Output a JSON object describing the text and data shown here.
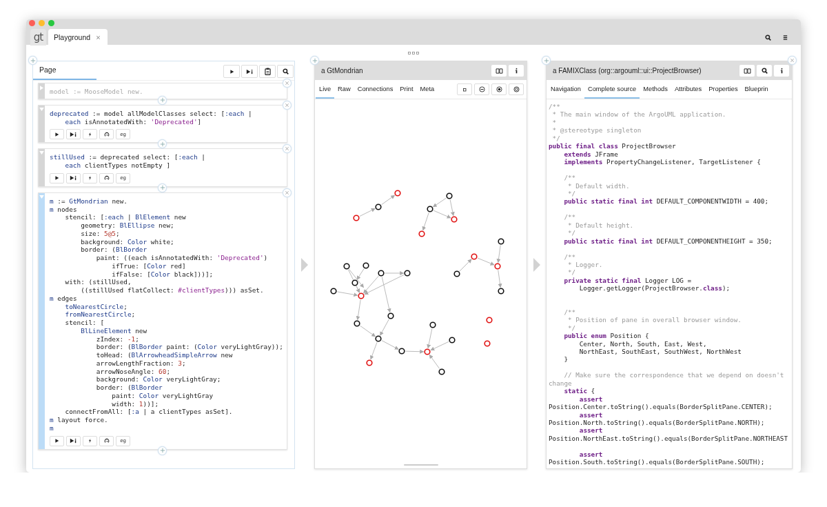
{
  "window": {
    "logo": "gt",
    "tabs": [
      {
        "label": "Playground",
        "selected": true,
        "closable": true
      }
    ]
  },
  "page_pane": {
    "tabs": [
      {
        "label": "Page",
        "selected": true
      }
    ],
    "actions": [
      {
        "kind": "run"
      },
      {
        "kind": "run_inspect"
      },
      {
        "kind": "copy"
      },
      {
        "kind": "search"
      }
    ],
    "snippets": [
      {
        "collapsed": true,
        "focused": false,
        "lines": [
          "model := MooseModel new."
        ]
      },
      {
        "collapsed": false,
        "focused": false,
        "actions": [
          {
            "kind": "run"
          },
          {
            "kind": "run_inspect"
          },
          {
            "kind": "debug"
          },
          {
            "kind": "profile"
          },
          {
            "kind": "examples",
            "label": "eg"
          }
        ],
        "lines": [
          "deprecated := model allModelClasses select: [:each |",
          "    each isAnnotatedWith: 'Deprecated']"
        ]
      },
      {
        "collapsed": false,
        "focused": false,
        "actions": [
          {
            "kind": "run"
          },
          {
            "kind": "run_inspect"
          },
          {
            "kind": "debug"
          },
          {
            "kind": "profile"
          },
          {
            "kind": "examples",
            "label": "eg"
          }
        ],
        "lines": [
          "stillUsed := deprecated select: [:each |",
          "    each clientTypes notEmpty ]"
        ]
      },
      {
        "collapsed": false,
        "focused": true,
        "actions": [
          {
            "kind": "run"
          },
          {
            "kind": "run_inspect"
          },
          {
            "kind": "debug"
          },
          {
            "kind": "profile"
          },
          {
            "kind": "examples",
            "label": "eg"
          }
        ],
        "lines": [
          "m := GtMondrian new.",
          "m nodes",
          "    stencil: [:each | BlElement new",
          "        geometry: BlEllipse new;",
          "        size: 5@5;",
          "        background: Color white;",
          "        border: (BlBorder",
          "            paint: ((each isAnnotatedWith: 'Deprecated')",
          "                ifTrue: [Color red]",
          "                ifFalse: [Color black]))];",
          "    with: (stillUsed,",
          "        ((stillUsed flatCollect: #clientTypes))) asSet.",
          "m edges",
          "    toNearestCircle;",
          "    fromNearestCircle;",
          "    stencil: [",
          "        BlLineElement new",
          "            zIndex: -1;",
          "            border: (BlBorder paint: (Color veryLightGray));",
          "            toHead: (BlArrowheadSimpleArrow new",
          "            arrowLengthFraction: 3;",
          "            arrowNoseAngle: 60;",
          "            background: Color veryLightGray;",
          "            border: (BlBorder",
          "                paint: Color veryLightGray",
          "                width: 1))];",
          "    connectFromAll: [:a | a clientTypes asSet].",
          "m layout force.",
          "m"
        ]
      }
    ]
  },
  "inspectors": [
    {
      "title": "a GtMondrian",
      "closable": false,
      "actions": [
        {
          "kind": "book"
        },
        {
          "kind": "info"
        }
      ],
      "tabs": [
        {
          "label": "Live",
          "selected": true
        },
        {
          "label": "Raw",
          "selected": false
        },
        {
          "label": "Connections",
          "selected": false
        },
        {
          "label": "Print",
          "selected": false
        },
        {
          "label": "Meta",
          "selected": false
        }
      ],
      "view_actions": [
        {
          "kind": "square"
        },
        {
          "kind": "zoom_out"
        },
        {
          "kind": "zoom_fit"
        },
        {
          "kind": "zoom_reset"
        }
      ],
      "view": {
        "kind": "graph"
      }
    },
    {
      "title": "a FAMIXClass (org::argouml::ui::ProjectBrowser)",
      "closable": true,
      "actions": [
        {
          "kind": "book"
        },
        {
          "kind": "search"
        },
        {
          "kind": "info"
        }
      ],
      "tabs": [
        {
          "label": "Navigation",
          "selected": false
        },
        {
          "label": "Complete source",
          "selected": true
        },
        {
          "label": "Methods",
          "selected": false
        },
        {
          "label": "Attributes",
          "selected": false
        },
        {
          "label": "Properties",
          "selected": false
        },
        {
          "label": "Blueprin",
          "selected": false
        }
      ],
      "view": {
        "kind": "source",
        "lines": [
          {
            "kind": "comment",
            "text": "/**"
          },
          {
            "kind": "comment",
            "text": " * The main window of the ArgoUML application."
          },
          {
            "kind": "comment",
            "text": " *"
          },
          {
            "kind": "comment",
            "text": " * @stereotype singleton"
          },
          {
            "kind": "comment",
            "text": " */"
          },
          {
            "kind": "code",
            "text": "**public final class** ProjectBrowser"
          },
          {
            "kind": "code",
            "text": "    **extends** JFrame"
          },
          {
            "kind": "code",
            "text": "    **implements** PropertyChangeListener, TargetListener {"
          },
          {
            "kind": "blank"
          },
          {
            "kind": "comment",
            "text": "    /**"
          },
          {
            "kind": "comment",
            "text": "     * Default width."
          },
          {
            "kind": "comment",
            "text": "     */"
          },
          {
            "kind": "code",
            "text": "    **public static final int** DEFAULT_COMPONENTWIDTH = 400;"
          },
          {
            "kind": "blank"
          },
          {
            "kind": "comment",
            "text": "    /**"
          },
          {
            "kind": "comment",
            "text": "     * Default height."
          },
          {
            "kind": "comment",
            "text": "     */"
          },
          {
            "kind": "code",
            "text": "    **public static final int** DEFAULT_COMPONENTHEIGHT = 350;"
          },
          {
            "kind": "blank"
          },
          {
            "kind": "comment",
            "text": "    /**"
          },
          {
            "kind": "comment",
            "text": "     * Logger."
          },
          {
            "kind": "comment",
            "text": "     */"
          },
          {
            "kind": "code",
            "text": "    **private static final** Logger LOG ="
          },
          {
            "kind": "code",
            "text": "        Logger.getLogger(ProjectBrowser.**class**);"
          },
          {
            "kind": "blank"
          },
          {
            "kind": "blank"
          },
          {
            "kind": "comment",
            "text": "    /**"
          },
          {
            "kind": "comment",
            "text": "     * Position of pane in overall browser window."
          },
          {
            "kind": "comment",
            "text": "     */"
          },
          {
            "kind": "code",
            "text": "    **public enum** Position {"
          },
          {
            "kind": "code",
            "text": "        Center, North, South, East, West,"
          },
          {
            "kind": "code",
            "text": "        NorthEast, SouthEast, SouthWest, NorthWest"
          },
          {
            "kind": "code",
            "text": "    }"
          },
          {
            "kind": "blank"
          },
          {
            "kind": "comment",
            "text": "    // Make sure the correspondence that we depend on doesn't"
          },
          {
            "kind": "comment",
            "text": "change"
          },
          {
            "kind": "code",
            "text": "    **static** {"
          },
          {
            "kind": "code",
            "text": "        **assert**"
          },
          {
            "kind": "code",
            "text": "Position.Center.toString().equals(BorderSplitPane.CENTER);"
          },
          {
            "kind": "code",
            "text": "        **assert**"
          },
          {
            "kind": "code",
            "text": "Position.North.toString().equals(BorderSplitPane.NORTH);"
          },
          {
            "kind": "code",
            "text": "        **assert**"
          },
          {
            "kind": "code",
            "text": "Position.NorthEast.toString().equals(BorderSplitPane.NORTHEAST"
          },
          {
            "kind": "blank"
          },
          {
            "kind": "code",
            "text": "        **assert**"
          },
          {
            "kind": "code",
            "text": "Position.South.toString().equals(BorderSplitPane.SOUTH);"
          }
        ]
      }
    }
  ]
}
